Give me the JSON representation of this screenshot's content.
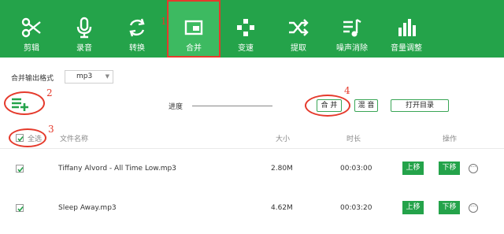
{
  "toolbar": {
    "items": [
      {
        "label": "剪辑",
        "icon": "scissors-icon"
      },
      {
        "label": "录音",
        "icon": "microphone-icon"
      },
      {
        "label": "转换",
        "icon": "convert-icon"
      },
      {
        "label": "合并",
        "icon": "merge-icon"
      },
      {
        "label": "变速",
        "icon": "speed-icon"
      },
      {
        "label": "提取",
        "icon": "extract-icon"
      },
      {
        "label": "噪声消除",
        "icon": "noise-removal-icon"
      },
      {
        "label": "音量调整",
        "icon": "volume-icon"
      }
    ],
    "active_index": 3
  },
  "format": {
    "label": "合并输出格式",
    "value": "mp3"
  },
  "progress": {
    "label": "进度",
    "value": 0
  },
  "actions": {
    "merge": "合 并",
    "mix": "混 音",
    "open_folder": "打开目录"
  },
  "annotations": [
    "1",
    "2",
    "3",
    "4"
  ],
  "table": {
    "select_all": "全选",
    "headers": {
      "name": "文件名称",
      "size": "大小",
      "duration": "时长",
      "ops": "操作"
    },
    "rows": [
      {
        "name": "Tiffany Alvord - All Time Low.mp3",
        "size": "2.80M",
        "duration": "00:03:00",
        "up": "上移",
        "down": "下移",
        "checked": true
      },
      {
        "name": "Sleep Away.mp3",
        "size": "4.62M",
        "duration": "00:03:20",
        "up": "上移",
        "down": "下移",
        "checked": true
      }
    ]
  },
  "colors": {
    "brand_green": "#24a34a",
    "annotation_red": "#e53a2c"
  }
}
